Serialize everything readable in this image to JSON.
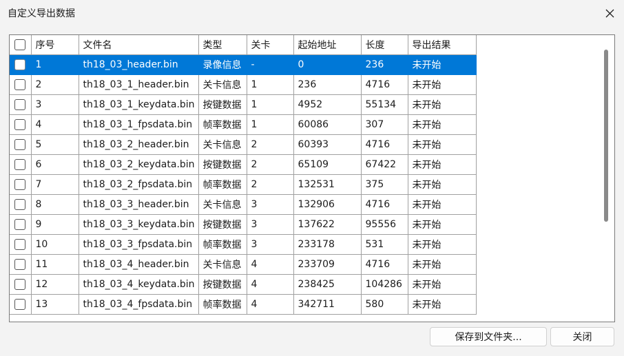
{
  "window": {
    "title": "自定义导出数据"
  },
  "table": {
    "columns": [
      "",
      "序号",
      "文件名",
      "类型",
      "关卡",
      "起始地址",
      "长度",
      "导出结果"
    ],
    "rows": [
      [
        "1",
        "th18_03_header.bin",
        "录像信息",
        "-",
        "0",
        "236",
        "未开始"
      ],
      [
        "2",
        "th18_03_1_header.bin",
        "关卡信息",
        "1",
        "236",
        "4716",
        "未开始"
      ],
      [
        "3",
        "th18_03_1_keydata.bin",
        "按键数据",
        "1",
        "4952",
        "55134",
        "未开始"
      ],
      [
        "4",
        "th18_03_1_fpsdata.bin",
        "帧率数据",
        "1",
        "60086",
        "307",
        "未开始"
      ],
      [
        "5",
        "th18_03_2_header.bin",
        "关卡信息",
        "2",
        "60393",
        "4716",
        "未开始"
      ],
      [
        "6",
        "th18_03_2_keydata.bin",
        "按键数据",
        "2",
        "65109",
        "67422",
        "未开始"
      ],
      [
        "7",
        "th18_03_2_fpsdata.bin",
        "帧率数据",
        "2",
        "132531",
        "375",
        "未开始"
      ],
      [
        "8",
        "th18_03_3_header.bin",
        "关卡信息",
        "3",
        "132906",
        "4716",
        "未开始"
      ],
      [
        "9",
        "th18_03_3_keydata.bin",
        "按键数据",
        "3",
        "137622",
        "95556",
        "未开始"
      ],
      [
        "10",
        "th18_03_3_fpsdata.bin",
        "帧率数据",
        "3",
        "233178",
        "531",
        "未开始"
      ],
      [
        "11",
        "th18_03_4_header.bin",
        "关卡信息",
        "4",
        "233709",
        "4716",
        "未开始"
      ],
      [
        "12",
        "th18_03_4_keydata.bin",
        "按键数据",
        "4",
        "238425",
        "104286",
        "未开始"
      ],
      [
        "13",
        "th18_03_4_fpsdata.bin",
        "帧率数据",
        "4",
        "342711",
        "580",
        "未开始"
      ]
    ],
    "selected_row": 0
  },
  "buttons": {
    "save": "保存到文件夹...",
    "close": "关闭"
  },
  "colors": {
    "selection": "#0078d7",
    "background": "#f3f3f3"
  },
  "icons": {
    "close": "close-icon",
    "checkbox": "checkbox"
  }
}
